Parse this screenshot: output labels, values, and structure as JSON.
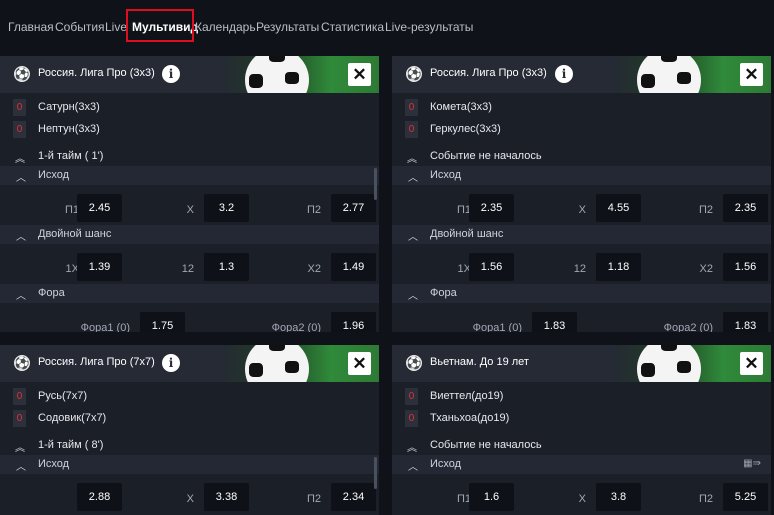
{
  "nav": {
    "items": [
      "Главная",
      "События",
      "Live",
      "Мультивид",
      "Календарь",
      "Результаты",
      "Статистика",
      "Live-результаты"
    ],
    "active": "Мультивид"
  },
  "colors": {
    "active_frame": "#e00d1e",
    "score": "#e0303a",
    "banner_green": "#2f8a3a"
  },
  "icons": {
    "close": "close-icon",
    "info": "info-icon",
    "ball": "soccer-ball-icon",
    "chevron": "chevron-up-icon",
    "stats": "stats-icon"
  },
  "panels": [
    {
      "league": "Россия. Лига Про (3х3)",
      "teams": [
        {
          "score": "0",
          "name": "Сатурн(3х3)"
        },
        {
          "score": "0",
          "name": "Нептун(3х3)"
        }
      ],
      "status": "1-й тайм   ( 1')",
      "markets": [
        {
          "label": "Исход",
          "odds": [
            {
              "label": "П1",
              "value": "2.45"
            },
            {
              "label": "X",
              "value": "3.2"
            },
            {
              "label": "П2",
              "value": "2.77"
            }
          ]
        },
        {
          "label": "Двойной шанс",
          "odds": [
            {
              "label": "1X",
              "value": "1.39"
            },
            {
              "label": "12",
              "value": "1.3"
            },
            {
              "label": "X2",
              "value": "1.49"
            }
          ]
        },
        {
          "label": "Фора",
          "odds": [
            {
              "label": "Фора1 (0)",
              "value": "1.75"
            },
            {
              "label": "Фора2 (0)",
              "value": "1.96"
            }
          ]
        }
      ]
    },
    {
      "league": "Россия. Лига Про (3х3)",
      "teams": [
        {
          "score": "0",
          "name": "Комета(3х3)"
        },
        {
          "score": "0",
          "name": "Геркулес(3х3)"
        }
      ],
      "status": "Событие не началось",
      "markets": [
        {
          "label": "Исход",
          "odds": [
            {
              "label": "П1",
              "value": "2.35"
            },
            {
              "label": "X",
              "value": "4.55"
            },
            {
              "label": "П2",
              "value": "2.35"
            }
          ]
        },
        {
          "label": "Двойной шанс",
          "odds": [
            {
              "label": "1X",
              "value": "1.56"
            },
            {
              "label": "12",
              "value": "1.18"
            },
            {
              "label": "X2",
              "value": "1.56"
            }
          ]
        },
        {
          "label": "Фора",
          "odds": [
            {
              "label": "Фора1 (0)",
              "value": "1.83"
            },
            {
              "label": "Фора2 (0)",
              "value": "1.83"
            }
          ]
        }
      ]
    },
    {
      "league": "Россия. Лига Про (7х7)",
      "teams": [
        {
          "score": "0",
          "name": "Русь(7х7)"
        },
        {
          "score": "0",
          "name": "Содовик(7х7)"
        }
      ],
      "status": "1-й тайм   ( 8')",
      "markets": [
        {
          "label": "Исход",
          "odds": [
            {
              "label": "П1",
              "value": "2.88"
            },
            {
              "label": "X",
              "value": "3.38"
            },
            {
              "label": "П2",
              "value": "2.34"
            }
          ]
        }
      ]
    },
    {
      "league": "Вьетнам. До 19 лет",
      "teams": [
        {
          "score": "0",
          "name": "Виеттел(до19)"
        },
        {
          "score": "0",
          "name": "Тханьхоа(до19)"
        }
      ],
      "status": "Событие не началось",
      "markets": [
        {
          "label": "Исход",
          "odds": [
            {
              "label": "П1",
              "value": "1.6"
            },
            {
              "label": "X",
              "value": "3.8"
            },
            {
              "label": "П2",
              "value": "5.25"
            }
          ]
        }
      ]
    }
  ]
}
